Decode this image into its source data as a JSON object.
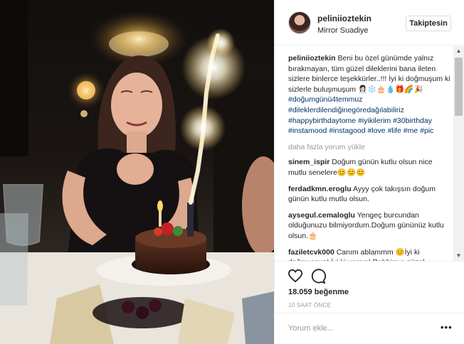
{
  "post": {
    "username": "peliniioztekin",
    "location": "Mirror Suadiye",
    "follow_label": "Takiptesin",
    "caption_user": "peliniioztekin",
    "caption_text": "Beni bu özel günümde yalnız bırakmayan, tüm güzel dileklerini bana ileten sizlere binlerce teşekkürler..!!! İyi ki doğmuşum ki sizlerle buluşmuşum 👩🏻‍💼❄️🎂💧🎁🌈🎉",
    "hashtags": [
      "#doğumgünü4temmuz",
      "#dileklerdilendiğinegöredağılabiliriz",
      "#happybirthdaytome",
      "#iyikilerim",
      "#30birthday",
      "#instamood",
      "#instagood",
      "#love",
      "#life",
      "#me",
      "#pic"
    ],
    "load_more_label": "daha fazla yorum yükle",
    "comments": [
      {
        "user": "sinem_ispir",
        "text": "Doğum günün kutlu olsun nice mutlu senelere😊😊😊"
      },
      {
        "user": "ferdadkmn.eroglu",
        "text": "Ayyy çok takışsın doğum günün kutlu mutlu olsun."
      },
      {
        "user": "aysegul.cemaloglu",
        "text": "Yengeç burcundan olduğunuzu bilmiyordum.Doğum gününüz kutlu olsun.🎂"
      },
      {
        "user": "faziletcvk000",
        "text": "Canım ablammm 😊İyi ki doğmuşsun! İyi ki varsın! Rabbim o güzel"
      }
    ],
    "likes": "18.059 beğenme",
    "time_ago": "10 SAAT ÖNCE",
    "comment_placeholder": "Yorum ekle...",
    "options_glyph": "•••"
  },
  "icons": {
    "heart": "heart-outline-icon",
    "comment": "speech-bubble-icon",
    "options": "more-options-icon"
  },
  "colors": {
    "hashtag": "#003569",
    "muted": "#999999",
    "border": "#efefef"
  }
}
